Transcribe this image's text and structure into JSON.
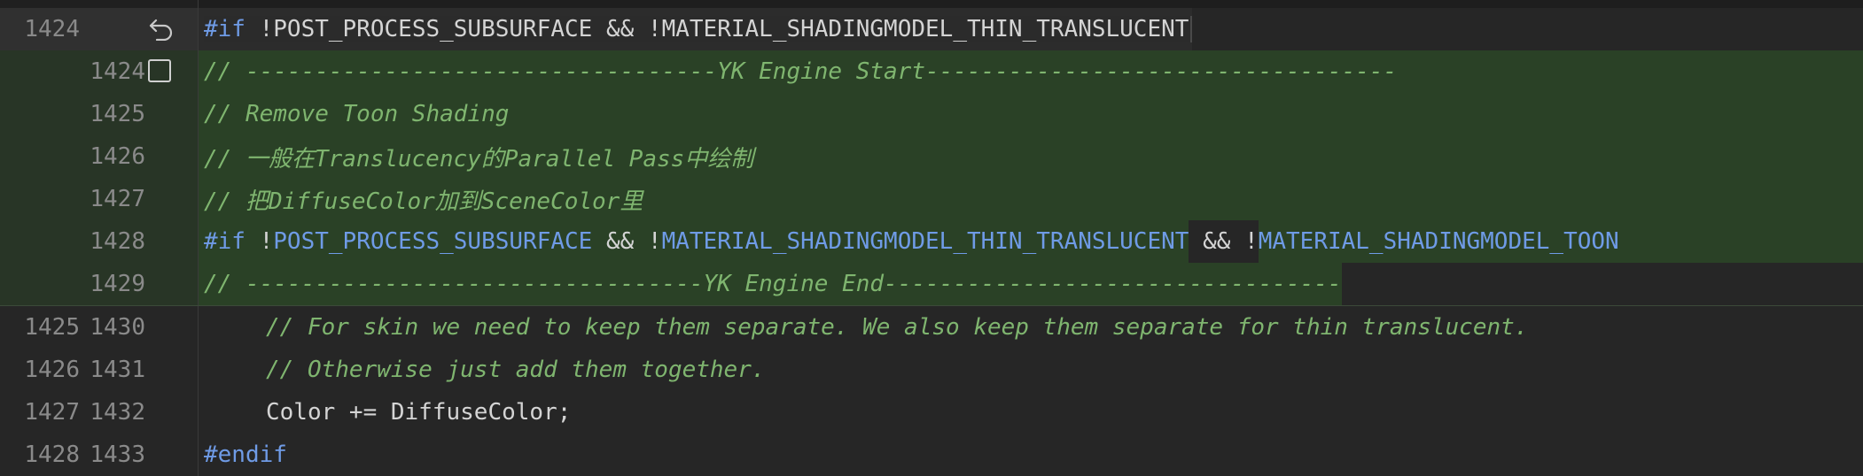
{
  "lines": {
    "l0": {
      "old": "1424",
      "new": "",
      "kw": "#if",
      "t1": " !",
      "m1": "POST_PROCESS_SUBSURFACE",
      "t2": " && !",
      "m2": "MATERIAL_SHADINGMODEL_THIN_TRANSLUCENT"
    },
    "l1": {
      "old": "",
      "new": "1424",
      "text": "// ----------------------------------YK Engine Start----------------------------------"
    },
    "l2": {
      "old": "",
      "new": "1425",
      "text": "// Remove Toon Shading"
    },
    "l3": {
      "old": "",
      "new": "1426",
      "text": "// 一般在Translucency的Parallel Pass中绘制"
    },
    "l4": {
      "old": "",
      "new": "1427",
      "text": "// 把DiffuseColor加到SceneColor里"
    },
    "l5": {
      "old": "",
      "new": "1428",
      "kw": "#if",
      "t1": " !",
      "m1": "POST_PROCESS_SUBSURFACE",
      "t2": " && !",
      "m2": "MATERIAL_SHADINGMODEL_THIN_TRANSLUCENT",
      "t3": " && !",
      "m3": "MATERIAL_SHADINGMODEL_TOON"
    },
    "l6": {
      "old": "",
      "new": "1429",
      "text": "// ---------------------------------YK Engine End---------------------------------"
    },
    "l7": {
      "old": "1425",
      "new": "1430",
      "text": "// For skin we need to keep them separate. We also keep them separate for thin translucent."
    },
    "l8": {
      "old": "1426",
      "new": "1431",
      "text": "// Otherwise just add them together."
    },
    "l9": {
      "old": "1427",
      "new": "1432",
      "text": "Color += DiffuseColor;"
    },
    "l10": {
      "old": "1428",
      "new": "1433",
      "kw": "#endif"
    }
  },
  "icons": {
    "revert": "undo-arrow-icon",
    "checkbox": "checkbox-icon"
  },
  "colors": {
    "background": "#262626",
    "added": "#2a4126",
    "comment": "#7fb56f",
    "keyword": "#6f9be6",
    "text": "#d4d4d4"
  }
}
